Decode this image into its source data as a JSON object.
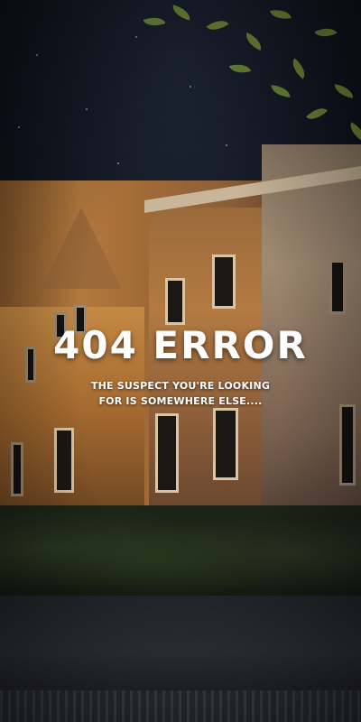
{
  "error_page": {
    "title": "404 ERROR",
    "message_line_1": "THE SUSPECT YOU'RE LOOKING",
    "message_line_2": "FOR IS SOMEWHERE ELSE...."
  },
  "background": {
    "description_icon": "abandoned-house-night-image",
    "text_color": "#ffffff"
  }
}
